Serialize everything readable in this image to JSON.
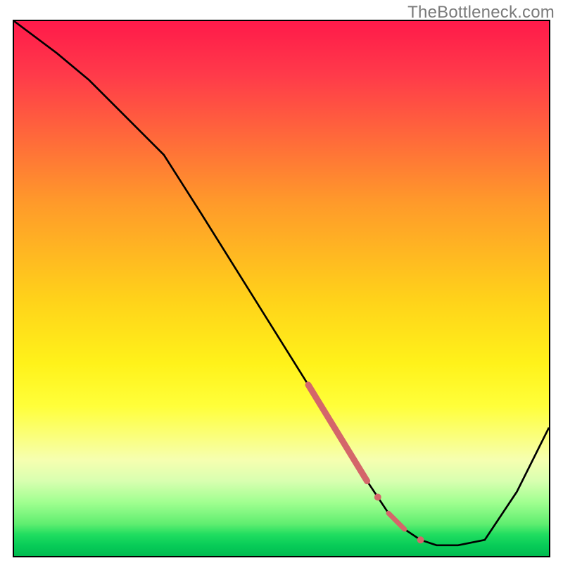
{
  "watermark": "TheBottleneck.com",
  "chart_data": {
    "type": "line",
    "title": "",
    "xlabel": "",
    "ylabel": "",
    "xlim": [
      0,
      100
    ],
    "ylim": [
      0,
      100
    ],
    "grid": false,
    "legend": false,
    "series": [
      {
        "name": "bottleneck-curve",
        "color": "#000000",
        "x": [
          0,
          8,
          14,
          20,
          26,
          28,
          35,
          45,
          55,
          60,
          63,
          66,
          68,
          70,
          73,
          76,
          79,
          83,
          88,
          94,
          100
        ],
        "y": [
          100,
          94,
          89,
          83,
          77,
          75,
          64,
          48,
          32,
          24,
          19,
          14,
          11,
          8,
          5,
          3,
          2,
          2,
          3,
          12,
          24
        ]
      }
    ],
    "markers": [
      {
        "name": "highlighted-range-wide",
        "shape": "line-segment",
        "color": "#d4666a",
        "width": 9,
        "x_start": 55,
        "y_start": 32,
        "x_end": 66,
        "y_end": 14
      },
      {
        "name": "highlighted-dot-upper",
        "shape": "dot",
        "color": "#d4666a",
        "r": 5,
        "x": 68,
        "y": 11
      },
      {
        "name": "highlighted-range-lower",
        "shape": "line-segment",
        "color": "#d4666a",
        "width": 7,
        "x_start": 70,
        "y_start": 8,
        "x_end": 73,
        "y_end": 5
      },
      {
        "name": "highlighted-dot-lower",
        "shape": "dot",
        "color": "#d4666a",
        "r": 5,
        "x": 76,
        "y": 3
      }
    ],
    "gradient_stops": [
      {
        "pct": 0,
        "color": "#ff1a4a"
      },
      {
        "pct": 50,
        "color": "#ffd21a"
      },
      {
        "pct": 80,
        "color": "#faff80"
      },
      {
        "pct": 100,
        "color": "#00bb50"
      }
    ]
  }
}
